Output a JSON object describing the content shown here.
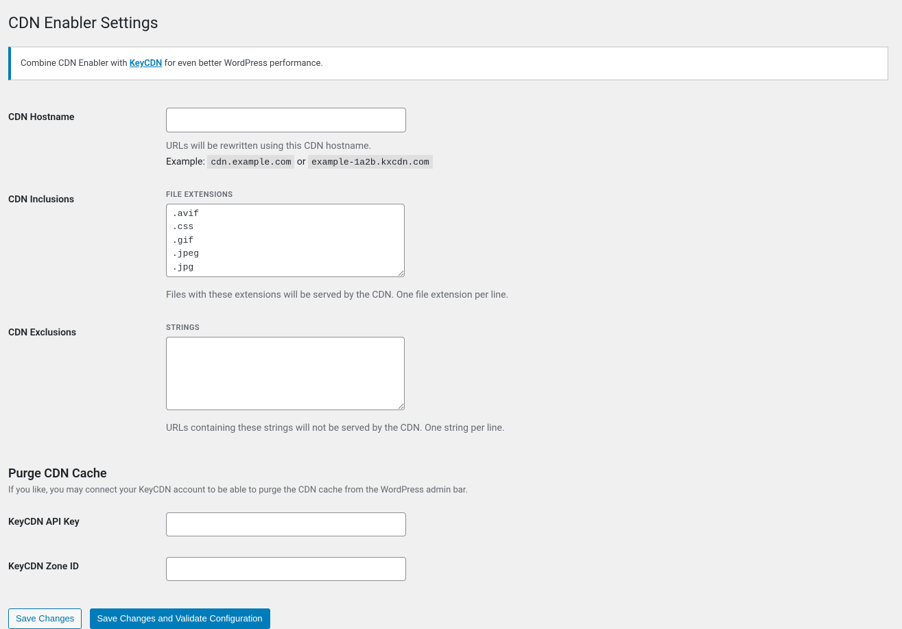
{
  "page": {
    "title": "CDN Enabler Settings"
  },
  "notice": {
    "prefix": "Combine CDN Enabler with ",
    "link_text": "KeyCDN",
    "suffix": " for even better WordPress performance."
  },
  "fields": {
    "hostname": {
      "label": "CDN Hostname",
      "value": "",
      "description_line1": "URLs will be rewritten using this CDN hostname.",
      "example_prefix": "Example: ",
      "example_code1": "cdn.example.com",
      "example_or": " or ",
      "example_code2": "example-1a2b.kxcdn.com"
    },
    "inclusions": {
      "label": "CDN Inclusions",
      "subheading": "FILE EXTENSIONS",
      "value": ".avif\n.css\n.gif\n.jpeg\n.jpg",
      "description": "Files with these extensions will be served by the CDN. One file extension per line."
    },
    "exclusions": {
      "label": "CDN Exclusions",
      "subheading": "STRINGS",
      "value": "",
      "description": "URLs containing these strings will not be served by the CDN. One string per line."
    }
  },
  "purge_section": {
    "heading": "Purge CDN Cache",
    "description": "If you like, you may connect your KeyCDN account to be able to purge the CDN cache from the WordPress admin bar.",
    "api_key": {
      "label": "KeyCDN API Key",
      "value": ""
    },
    "zone_id": {
      "label": "KeyCDN Zone ID",
      "value": ""
    }
  },
  "buttons": {
    "save": "Save Changes",
    "save_validate": "Save Changes and Validate Configuration"
  }
}
